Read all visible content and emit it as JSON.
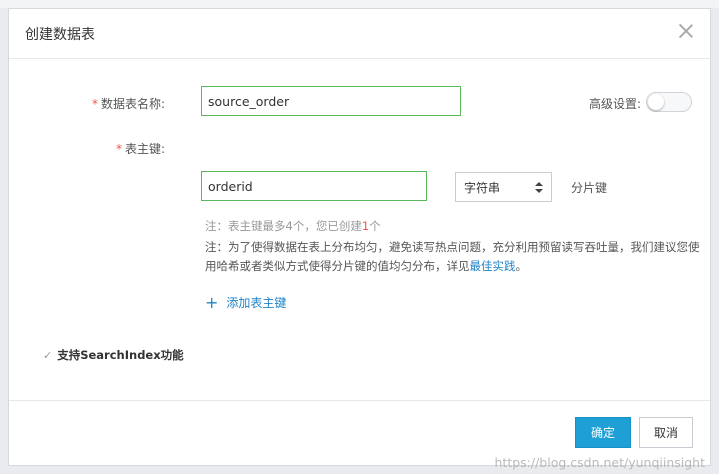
{
  "dialog": {
    "title": "创建数据表"
  },
  "form": {
    "table_name_label": "数据表名称:",
    "table_name_value": "source_order",
    "advanced_label": "高级设置:",
    "primary_key_label": "表主键:",
    "primary_key_value": "orderid",
    "primary_key_type": "字符串",
    "partition_key_label": "分片键",
    "note1_prefix": "注：表主键最多4个，您已创建",
    "note1_count": "1",
    "note1_suffix": "个",
    "note2_text": "注：为了使得数据在表上分布均匀，避免读写热点问题，充分利用预留读写吞吐量，我们建议您使用哈希或者类似方式使得分片键的值均匀分布，详见",
    "note2_link": "最佳实践",
    "note2_end": "。",
    "add_key_label": "添加表主键",
    "search_index_label": "支持SearchIndex功能",
    "required_mark": "*"
  },
  "footer": {
    "ok_label": "确定",
    "cancel_label": "取消"
  },
  "watermark": "https://blog.csdn.net/yunqiinsight",
  "colors": {
    "primary": "#1e9fd6",
    "input_border_active": "#5cb85c",
    "required": "#e54",
    "link": "#1f84c8"
  }
}
